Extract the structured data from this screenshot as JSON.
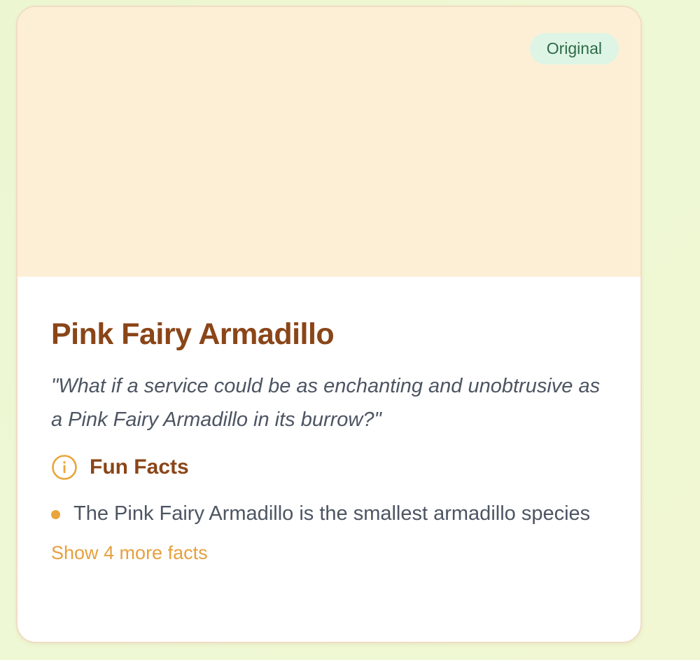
{
  "card": {
    "badge": "Original",
    "title": "Pink Fairy Armadillo",
    "quote": "\"What if a service could be as enchanting and unobtrusive as a Pink Fairy Armadillo in its burrow?\"",
    "facts_heading": "Fun Facts",
    "facts_icon": "info-circle-icon",
    "facts": [
      "The Pink Fairy Armadillo is the smallest armadillo species"
    ],
    "show_more_label": "Show 4 more facts"
  },
  "colors": {
    "hero_background": "#fdefd5",
    "title": "#8a4518",
    "accent": "#e9a53b",
    "badge_background": "#def5e6",
    "badge_text": "#2d6a45"
  }
}
